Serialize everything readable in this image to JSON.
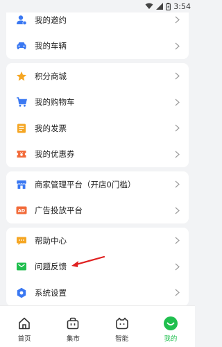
{
  "status_bar": {
    "time": "3:54"
  },
  "groups": [
    {
      "items": [
        {
          "label": "我的邀约",
          "icon": "person-invite-icon"
        },
        {
          "label": "我的车辆",
          "icon": "car-icon"
        }
      ]
    },
    {
      "items": [
        {
          "label": "积分商城",
          "icon": "star-icon"
        },
        {
          "label": "我的购物车",
          "icon": "shopping-cart-icon"
        },
        {
          "label": "我的发票",
          "icon": "invoice-icon"
        },
        {
          "label": "我的优惠券",
          "icon": "coupon-icon"
        }
      ]
    },
    {
      "items": [
        {
          "label": "商家管理平台（开店0门槛）",
          "icon": "shop-icon"
        },
        {
          "label": "广告投放平台",
          "icon": "ad-icon"
        }
      ]
    },
    {
      "items": [
        {
          "label": "帮助中心",
          "icon": "chat-bubble-icon"
        },
        {
          "label": "问题反馈",
          "icon": "feedback-mail-icon"
        },
        {
          "label": "系统设置",
          "icon": "settings-gear-icon"
        }
      ]
    }
  ],
  "ad_badge": "AD",
  "tabs": [
    {
      "label": "首页",
      "icon": "home-icon",
      "active": false
    },
    {
      "label": "集市",
      "icon": "basket-icon",
      "active": false
    },
    {
      "label": "智能",
      "icon": "robot-icon",
      "active": false
    },
    {
      "label": "我的",
      "icon": "profile-icon",
      "active": true
    }
  ],
  "colors": {
    "accent": "#1fbf4e",
    "icon_blue": "#3a78f2",
    "icon_orange": "#f5a623",
    "icon_red": "#f26b3a",
    "annotation_arrow": "#e02020"
  }
}
